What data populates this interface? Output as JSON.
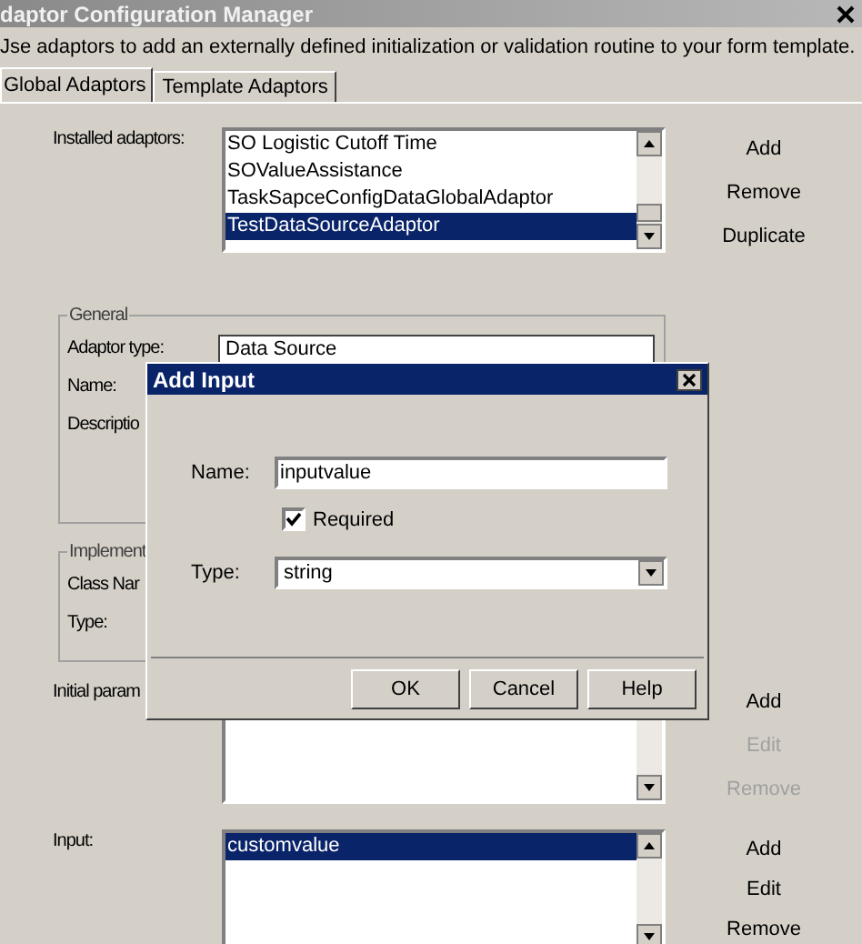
{
  "window": {
    "title": "daptor Configuration Manager"
  },
  "description": "Jse adaptors to add an externally defined initialization or validation routine to your form template.",
  "tabs": [
    {
      "label": "Global Adaptors",
      "selected": true
    },
    {
      "label": "Template Adaptors",
      "selected": false
    }
  ],
  "installed_adaptors": {
    "label": "Installed adaptors:",
    "items": [
      {
        "text": "SO Logistic Cutoff Time",
        "selected": false
      },
      {
        "text": "SOValueAssistance",
        "selected": false
      },
      {
        "text": "TaskSapceConfigDataGlobalAdaptor",
        "selected": false
      },
      {
        "text": "TestDataSourceAdaptor",
        "selected": true
      }
    ],
    "buttons": [
      {
        "label": "Add",
        "disabled": false
      },
      {
        "label": "Remove",
        "disabled": false
      },
      {
        "label": "Duplicate",
        "disabled": false
      }
    ]
  },
  "general": {
    "legend": "General",
    "fields": [
      {
        "label": "Adaptor type:",
        "value": "Data Source"
      },
      {
        "label": "Name:"
      },
      {
        "label": "Descriptio"
      }
    ]
  },
  "implementation": {
    "legend": "Implement",
    "fields": [
      {
        "label": "Class Nar"
      },
      {
        "label": "Type:"
      }
    ]
  },
  "initial_parameters": {
    "label": "Initial param",
    "buttons": [
      {
        "label": "Add",
        "disabled": false
      },
      {
        "label": "Edit",
        "disabled": true
      },
      {
        "label": "Remove",
        "disabled": true
      }
    ]
  },
  "input": {
    "label": "Input:",
    "items": [
      {
        "text": "customvalue",
        "selected": true
      }
    ],
    "buttons": [
      {
        "label": "Add",
        "disabled": false
      },
      {
        "label": "Edit",
        "disabled": false
      },
      {
        "label": "Remove",
        "disabled": false
      }
    ]
  },
  "dialog": {
    "title": "Add Input",
    "name_label": "Name:",
    "name_value": "inputvalue",
    "required": {
      "label": "Required",
      "checked": true
    },
    "type_label": "Type:",
    "type_value": "string",
    "buttons": [
      "OK",
      "Cancel",
      "Help"
    ]
  }
}
